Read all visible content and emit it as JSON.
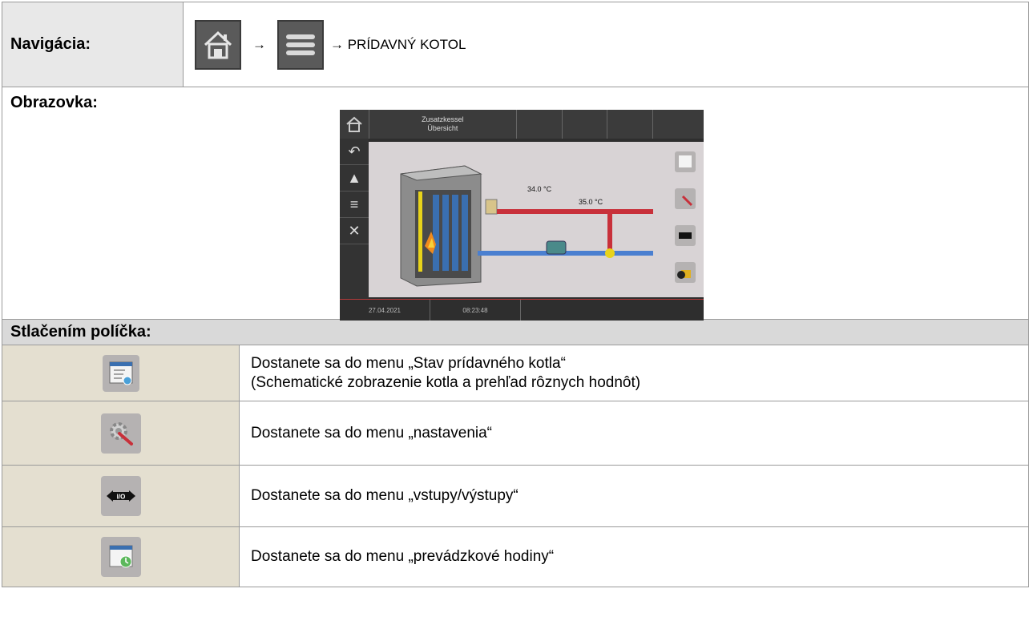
{
  "navigation": {
    "label": "Navigácia:",
    "arrow": "→",
    "target": "→ PRÍDAVNÝ KOTOL",
    "home_icon": "home-icon",
    "menu_icon": "menu-icon"
  },
  "screen_section": {
    "label": "Obrazovka:",
    "screen": {
      "title_line1": "Zusatzkessel",
      "title_line2": "Übersicht",
      "temp_top": "34.0 °C",
      "temp_right": "35.0 °C",
      "io_label": "I/O",
      "date": "27.04.2021",
      "time": "08:23:48"
    }
  },
  "press_section": {
    "label": "Stlačením políčka:",
    "items": [
      {
        "icon": "status-overview-icon",
        "line1": "Dostanete sa do menu „Stav prídavného kotla“",
        "line2": "(Schematické zobrazenie kotla a prehľad rôznych hodnôt)"
      },
      {
        "icon": "settings-icon",
        "line1": "Dostanete sa do menu „nastavenia“"
      },
      {
        "icon": "inputs-outputs-icon",
        "line1": "Dostanete sa do menu „vstupy/výstupy“",
        "io_label": "I/O"
      },
      {
        "icon": "operating-hours-icon",
        "line1": "Dostanete sa do menu „prevádzkové hodiny“"
      }
    ]
  },
  "colors": {
    "pipe_hot": "#c8303a",
    "pipe_cold": "#4a7fd0",
    "icon_bg": "#e4dfd0",
    "header_bg": "#d9d9d9"
  }
}
